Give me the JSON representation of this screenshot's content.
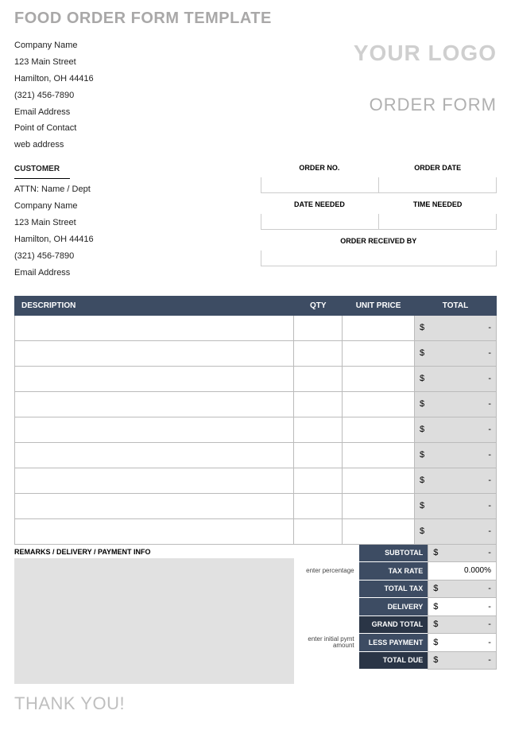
{
  "title": "FOOD ORDER FORM TEMPLATE",
  "logo_text": "YOUR LOGO",
  "order_form_label": "ORDER FORM",
  "company": {
    "name": "Company Name",
    "street": "123 Main Street",
    "city_line": "Hamilton, OH 44416",
    "phone": "(321) 456-7890",
    "email": "Email Address",
    "contact": "Point of Contact",
    "web": "web address"
  },
  "customer_label": "CUSTOMER",
  "customer": {
    "attn": "ATTN: Name / Dept",
    "company": "Company Name",
    "street": "123 Main Street",
    "city_line": "Hamilton, OH 44416",
    "phone": "(321) 456-7890",
    "email": "Email Address"
  },
  "meta": {
    "order_no_label": "ORDER NO.",
    "order_date_label": "ORDER DATE",
    "date_needed_label": "DATE NEEDED",
    "time_needed_label": "TIME NEEDED",
    "received_by_label": "ORDER RECEIVED BY"
  },
  "table": {
    "headers": {
      "desc": "DESCRIPTION",
      "qty": "QTY",
      "price": "UNIT PRICE",
      "total": "TOTAL"
    },
    "rows": [
      {
        "desc": "",
        "qty": "",
        "price": "",
        "total_currency": "$",
        "total_val": "-"
      },
      {
        "desc": "",
        "qty": "",
        "price": "",
        "total_currency": "$",
        "total_val": "-"
      },
      {
        "desc": "",
        "qty": "",
        "price": "",
        "total_currency": "$",
        "total_val": "-"
      },
      {
        "desc": "",
        "qty": "",
        "price": "",
        "total_currency": "$",
        "total_val": "-"
      },
      {
        "desc": "",
        "qty": "",
        "price": "",
        "total_currency": "$",
        "total_val": "-"
      },
      {
        "desc": "",
        "qty": "",
        "price": "",
        "total_currency": "$",
        "total_val": "-"
      },
      {
        "desc": "",
        "qty": "",
        "price": "",
        "total_currency": "$",
        "total_val": "-"
      },
      {
        "desc": "",
        "qty": "",
        "price": "",
        "total_currency": "$",
        "total_val": "-"
      },
      {
        "desc": "",
        "qty": "",
        "price": "",
        "total_currency": "$",
        "total_val": "-"
      }
    ]
  },
  "remarks_label": "REMARKS / DELIVERY / PAYMENT INFO",
  "totals": {
    "subtotal": {
      "label": "SUBTOTAL",
      "currency": "$",
      "val": "-",
      "hint": ""
    },
    "tax_rate": {
      "label": "TAX RATE",
      "currency": "",
      "val": "0.000%",
      "hint": "enter percentage"
    },
    "total_tax": {
      "label": "TOTAL TAX",
      "currency": "$",
      "val": "-",
      "hint": ""
    },
    "delivery": {
      "label": "DELIVERY",
      "currency": "$",
      "val": "-",
      "hint": ""
    },
    "grand_total": {
      "label": "GRAND TOTAL",
      "currency": "$",
      "val": "-",
      "hint": ""
    },
    "less_payment": {
      "label": "LESS PAYMENT",
      "currency": "$",
      "val": "-",
      "hint": "enter initial pymt amount"
    },
    "total_due": {
      "label": "TOTAL DUE",
      "currency": "$",
      "val": "-",
      "hint": ""
    }
  },
  "thank_you": "THANK YOU!"
}
